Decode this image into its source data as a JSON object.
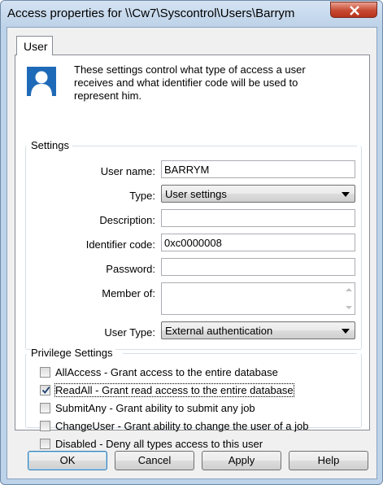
{
  "window": {
    "title": "Access properties for \\\\Cw7\\Syscontrol\\Users\\Barrym",
    "close_icon": "close-icon"
  },
  "tabs": [
    {
      "label": "User",
      "selected": true
    }
  ],
  "intro": {
    "icon": "user-icon",
    "text": "These settings control what type of access a user receives and what identifier code will be used to represent him."
  },
  "settings": {
    "group_label": "Settings",
    "user_name": {
      "label": "User name:",
      "value": "BARRYM"
    },
    "type": {
      "label": "Type:",
      "value": "User settings"
    },
    "description": {
      "label": "Description:",
      "value": ""
    },
    "identifier_code": {
      "label": "Identifier code:",
      "value": "0xc0000008"
    },
    "password": {
      "label": "Password:",
      "value": ""
    },
    "member_of": {
      "label": "Member of:",
      "value": ""
    },
    "user_type": {
      "label": "User Type:",
      "value": "External authentication"
    }
  },
  "privileges": {
    "group_label": "Privilege Settings",
    "items": [
      {
        "label": "AllAccess - Grant access to the entire database",
        "checked": false
      },
      {
        "label": "ReadAll - Grant read access to the entire database",
        "checked": true
      },
      {
        "label": "SubmitAny - Grant ability to submit any job",
        "checked": false
      },
      {
        "label": "ChangeUser - Grant ability to change the user of a job",
        "checked": false
      },
      {
        "label": "Disabled - Deny all types access to this user",
        "checked": false
      }
    ]
  },
  "buttons": {
    "ok": "OK",
    "cancel": "Cancel",
    "apply": "Apply",
    "help": "Help"
  }
}
